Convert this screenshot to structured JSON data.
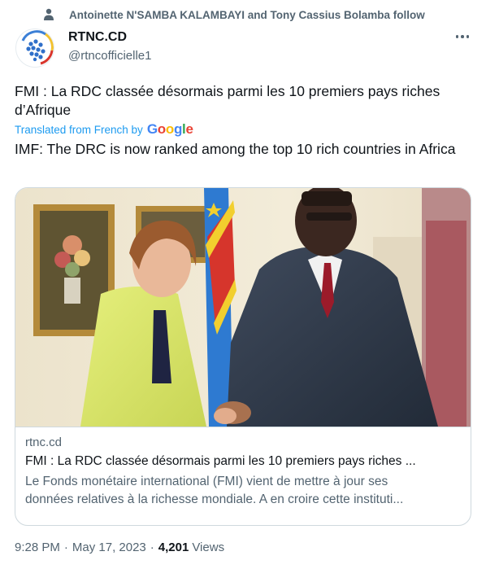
{
  "social_context": {
    "text": "Antoinette N'SAMBA KALAMBAYI and Tony Cassius Bolamba follow"
  },
  "author": {
    "name": "RTNC.CD",
    "handle": "@rtncofficielle1"
  },
  "tweet": {
    "original_text": "FMI : La RDC classée désormais parmi les 10 premiers pays riches d’Afrique",
    "translated_label": "Translated from French by",
    "translator": "Google",
    "translated_text": "IMF: The DRC is now ranked among the top 10 rich countries in Africa"
  },
  "card": {
    "domain": "rtnc.cd",
    "title": "FMI : La RDC classée désormais parmi les 10 premiers pays riches ...",
    "description_line1": "Le Fonds monétaire international (FMI) vient de mettre à jour ses",
    "description_line2": "données relatives à la richesse mondiale. A en croire cette instituti..."
  },
  "meta": {
    "time": "9:28 PM",
    "date": "May 17, 2023",
    "views_count": "4,201",
    "views_label": "Views",
    "separator": "·"
  },
  "icons": {
    "social_context": "person-icon",
    "more": "more-dots-icon",
    "avatar": "rtnc-logo"
  },
  "colors": {
    "link_blue": "#1d9bf0",
    "secondary_text": "#536471",
    "primary_text": "#0f1419",
    "border": "#cfd9de"
  }
}
